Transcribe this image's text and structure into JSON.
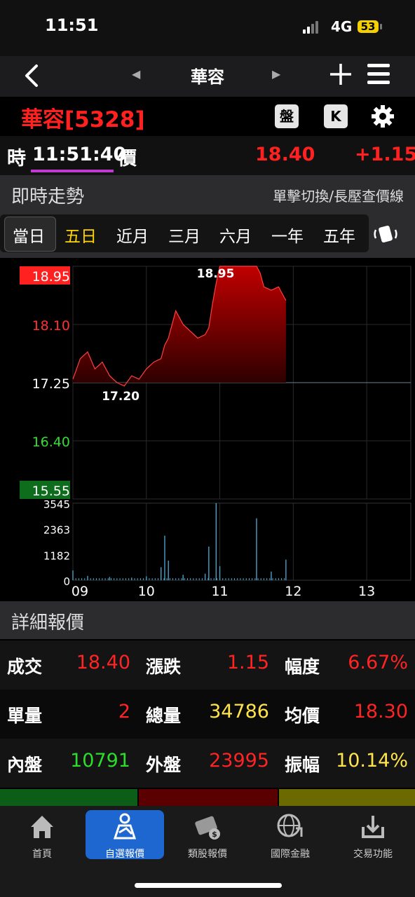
{
  "status": {
    "time": "11:51",
    "network": "4G",
    "battery": "53"
  },
  "nav": {
    "title": "華容"
  },
  "stock": {
    "name": "華容[5328]",
    "pan_btn": "盤",
    "k_btn": "K"
  },
  "price_row": {
    "time_label": "時",
    "time": "11:51:40",
    "price_label": "價",
    "price": "18.40",
    "change": "+1.15"
  },
  "trend_section": {
    "title": "即時走勢",
    "hint": "單擊切換/長壓查價線"
  },
  "tabs": [
    "當日",
    "五日",
    "近月",
    "三月",
    "六月",
    "一年",
    "五年"
  ],
  "tab_colors": [
    "#ffffff",
    "#ffd400",
    "#ffffff",
    "#ffffff",
    "#ffffff",
    "#ffffff",
    "#ffffff"
  ],
  "chart_data": {
    "type": "area",
    "y_ticks": [
      "18.95",
      "18.10",
      "17.25",
      "16.40",
      "15.55"
    ],
    "y_range": [
      15.55,
      18.95
    ],
    "reference": 17.25,
    "high_label": "18.95",
    "low_label": "17.20",
    "volume_ticks": [
      "3545",
      "2363",
      "1182",
      "0"
    ],
    "x_ticks": [
      "09",
      "10",
      "11",
      "12",
      "13"
    ],
    "price_x": [
      9.0,
      9.1,
      9.2,
      9.3,
      9.4,
      9.5,
      9.6,
      9.7,
      9.8,
      9.9,
      10.0,
      10.1,
      10.2,
      10.25,
      10.3,
      10.4,
      10.5,
      10.6,
      10.7,
      10.8,
      10.85,
      10.9,
      10.95,
      11.0,
      11.1,
      11.2,
      11.3,
      11.4,
      11.5,
      11.55,
      11.6,
      11.7,
      11.8,
      11.85,
      11.9
    ],
    "price_y": [
      17.3,
      17.6,
      17.7,
      17.45,
      17.55,
      17.35,
      17.25,
      17.2,
      17.35,
      17.3,
      17.45,
      17.55,
      17.6,
      17.8,
      17.9,
      18.3,
      18.1,
      18.0,
      17.9,
      17.95,
      18.05,
      18.4,
      18.7,
      18.95,
      18.95,
      18.95,
      18.95,
      18.95,
      18.95,
      18.85,
      18.65,
      18.6,
      18.65,
      18.55,
      18.45
    ],
    "volume_x": [
      9.0,
      9.2,
      9.5,
      9.8,
      10.0,
      10.2,
      10.25,
      10.3,
      10.5,
      10.8,
      10.85,
      10.95,
      11.0,
      11.5,
      11.7,
      11.9
    ],
    "volume_y": [
      450,
      200,
      150,
      120,
      180,
      600,
      2050,
      900,
      250,
      300,
      1550,
      3545,
      650,
      2850,
      400,
      950
    ]
  },
  "detail_section": {
    "title": "詳細報價"
  },
  "details": [
    [
      {
        "label": "成交",
        "value": "18.40",
        "color": "#ff2424"
      },
      {
        "label": "漲跌",
        "value": "1.15",
        "color": "#ff2424"
      },
      {
        "label": "幅度",
        "value": "6.67%",
        "color": "#ff2424"
      }
    ],
    [
      {
        "label": "單量",
        "value": "2",
        "color": "#ff2424"
      },
      {
        "label": "總量",
        "value": "34786",
        "color": "#ffe34d"
      },
      {
        "label": "均價",
        "value": "18.30",
        "color": "#ff2424"
      }
    ],
    [
      {
        "label": "內盤",
        "value": "10791",
        "color": "#2bde2b"
      },
      {
        "label": "外盤",
        "value": "23995",
        "color": "#ff2424"
      },
      {
        "label": "振幅",
        "value": "10.14%",
        "color": "#ffe34d"
      }
    ]
  ],
  "tabbar": {
    "items": [
      {
        "icon": "home-icon",
        "label": "首頁"
      },
      {
        "icon": "watchlist-icon",
        "label": "自選報價"
      },
      {
        "icon": "category-quote-icon",
        "label": "類股報價"
      },
      {
        "icon": "globe-icon",
        "label": "國際金融"
      },
      {
        "icon": "trade-icon",
        "label": "交易功能"
      }
    ],
    "active_color": "#1e66d0"
  }
}
